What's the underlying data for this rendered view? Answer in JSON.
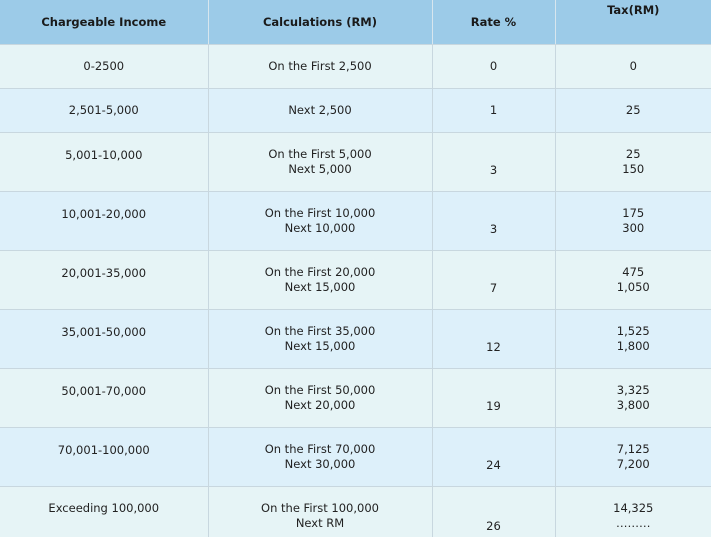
{
  "table": {
    "headers": [
      "Chargeable Income",
      "Calculations (RM)",
      "Rate %",
      "Tax(RM)"
    ],
    "rows": [
      {
        "income": "0-2500",
        "calc": [
          "On the First 2,500"
        ],
        "rate": "0",
        "tax": [
          "0"
        ]
      },
      {
        "income": "2,501-5,000",
        "calc": [
          "Next 2,500"
        ],
        "rate": "1",
        "tax": [
          "25"
        ]
      },
      {
        "income": "5,001-10,000",
        "calc": [
          "On the First 5,000",
          "Next 5,000"
        ],
        "rate": "3",
        "tax": [
          "25",
          "150"
        ]
      },
      {
        "income": "10,001-20,000",
        "calc": [
          "On the First 10,000",
          "Next 10,000"
        ],
        "rate": "3",
        "tax": [
          "175",
          "300"
        ]
      },
      {
        "income": "20,001-35,000",
        "calc": [
          "On the First 20,000",
          "Next 15,000"
        ],
        "rate": "7",
        "tax": [
          "475",
          "1,050"
        ]
      },
      {
        "income": "35,001-50,000",
        "calc": [
          "On the First 35,000",
          "Next 15,000"
        ],
        "rate": "12",
        "tax": [
          "1,525",
          "1,800"
        ]
      },
      {
        "income": "50,001-70,000",
        "calc": [
          "On the First 50,000",
          "Next 20,000"
        ],
        "rate": "19",
        "tax": [
          "3,325",
          "3,800"
        ]
      },
      {
        "income": "70,001-100,000",
        "calc": [
          "On the First 70,000",
          "Next 30,000"
        ],
        "rate": "24",
        "tax": [
          "7,125",
          "7,200"
        ]
      },
      {
        "income": "Exceeding 100,000",
        "calc": [
          "On the First 100,000",
          "Next RM"
        ],
        "rate": "26",
        "tax": [
          "14,325",
          "………"
        ]
      }
    ]
  }
}
